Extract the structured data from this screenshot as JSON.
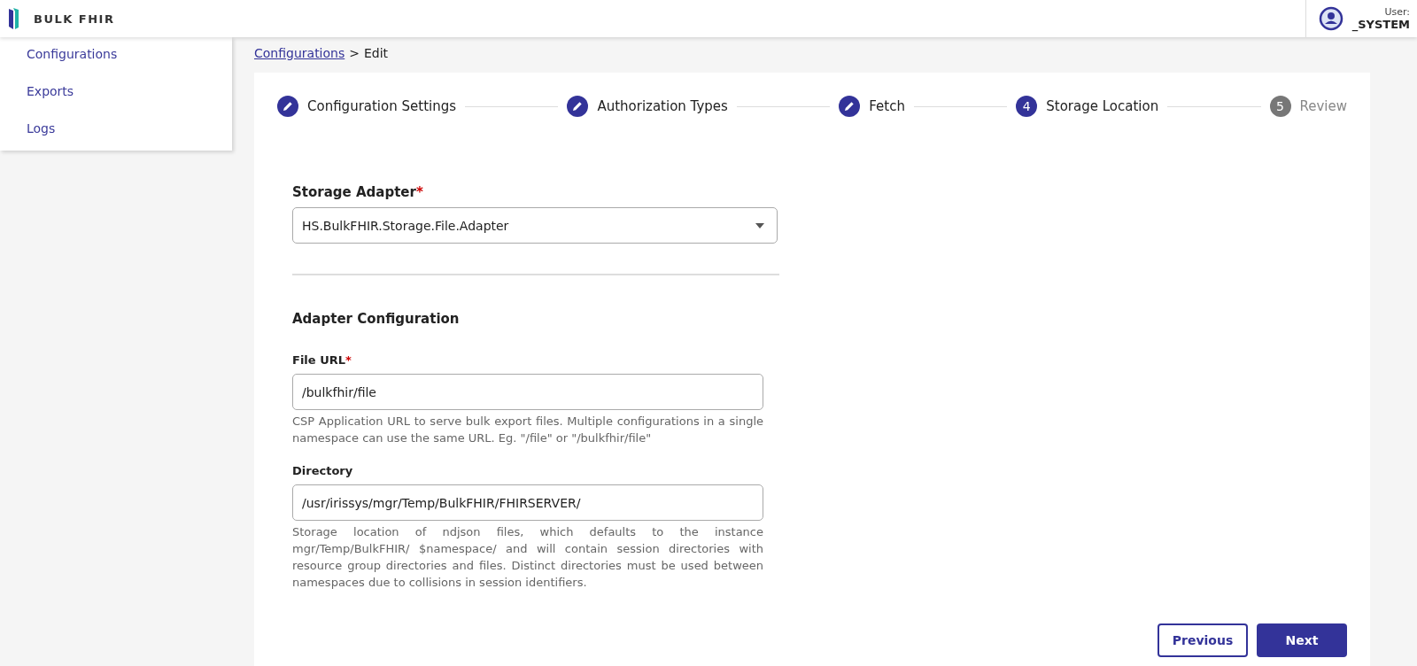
{
  "app": {
    "title": "BULK FHIR"
  },
  "user": {
    "label": "User:",
    "name": "_SYSTEM"
  },
  "sidebar": {
    "items": [
      {
        "label": "Configurations"
      },
      {
        "label": "Exports"
      },
      {
        "label": "Logs"
      }
    ]
  },
  "breadcrumb": {
    "link": "Configurations",
    "separator": ">",
    "current": "Edit"
  },
  "required_marker": "*",
  "steps": [
    {
      "label": "Configuration Settings",
      "kind": "done"
    },
    {
      "label": "Authorization Types",
      "kind": "done"
    },
    {
      "label": "Fetch",
      "kind": "done"
    },
    {
      "label": "Storage Location",
      "number": "4",
      "kind": "current"
    },
    {
      "label": "Review",
      "number": "5",
      "kind": "todo"
    }
  ],
  "storage_adapter": {
    "label": "Storage Adapter",
    "required": true,
    "value": "HS.BulkFHIR.Storage.File.Adapter"
  },
  "section_title": "Adapter Configuration",
  "fields": [
    {
      "label": "File URL",
      "required": true,
      "value": "/bulkfhir/file",
      "help": "CSP Application URL to serve bulk export files.  Multiple configurations in a single namespace can use the same URL. Eg. \"/file\" or \"/bulkfhir/file\""
    },
    {
      "label": "Directory",
      "required": false,
      "value": "/usr/irissys/mgr/Temp/BulkFHIR/FHIRSERVER/",
      "help": "Storage location of ndjson files, which defaults to the instance mgr/Temp/BulkFHIR/ $namespace/ and will contain  session directories with resource group directories and files.  Distinct directories must be used between namespaces due to collisions in session identifiers."
    }
  ],
  "buttons": {
    "previous": "Previous",
    "next": "Next"
  }
}
